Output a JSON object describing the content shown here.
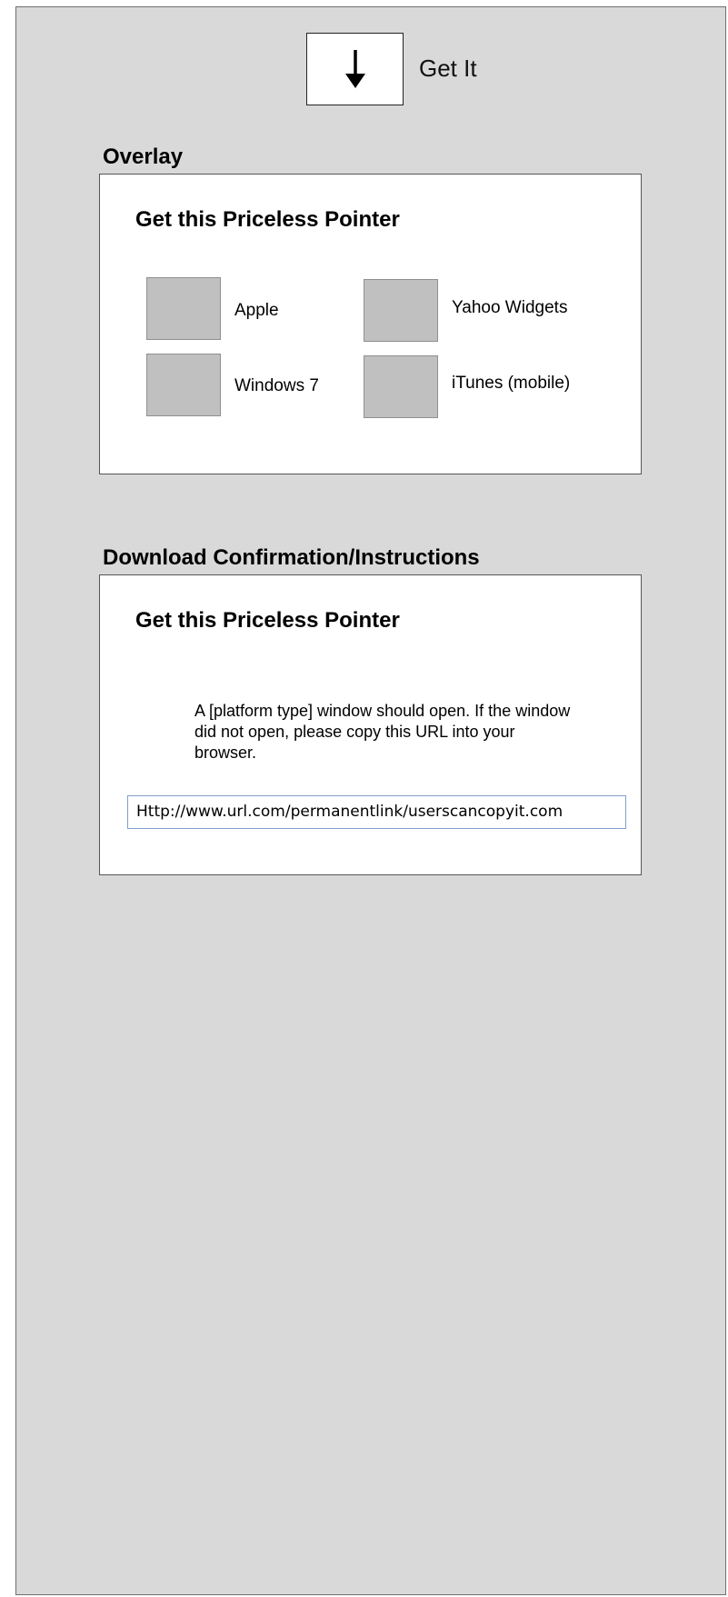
{
  "header": {
    "get_it_label": "Get It",
    "get_it_icon": "down-arrow-icon"
  },
  "overlay": {
    "section_title": "Overlay",
    "heading": "Get this Priceless Pointer",
    "options": [
      {
        "label": "Apple"
      },
      {
        "label": "Yahoo Widgets"
      },
      {
        "label": "Windows 7"
      },
      {
        "label": "iTunes (mobile)"
      }
    ]
  },
  "confirmation": {
    "section_title": "Download Confirmation/Instructions",
    "heading": "Get this Priceless Pointer",
    "instructions": "A [platform type] window should open. If the window did not open, please copy this URL into your browser.",
    "url_value": "Http://www.url.com/permanentlink/userscancopyit.com"
  },
  "colors": {
    "canvas_bg": "#d9d9d9",
    "thumb_bg": "#c0c0c0",
    "url_border": "#7f9fc6"
  }
}
